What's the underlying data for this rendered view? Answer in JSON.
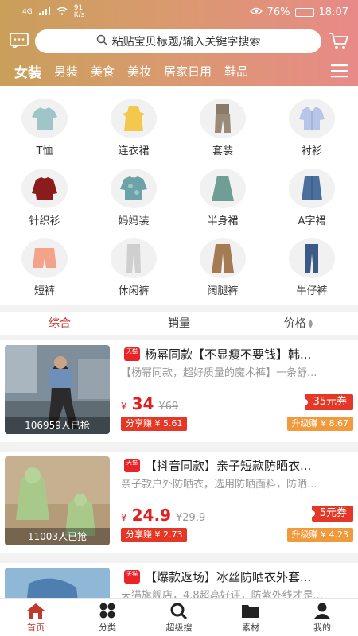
{
  "status": {
    "network": "4G",
    "speed": "91",
    "speed_unit": "K/s",
    "battery": "76%",
    "time": "18:07"
  },
  "search": {
    "placeholder": "粘贴宝贝标题/输入关键字搜索"
  },
  "categories": [
    "女装",
    "男装",
    "美食",
    "美妆",
    "居家日用",
    "鞋品"
  ],
  "subcategories": [
    "T恤",
    "连衣裙",
    "套装",
    "衬衫",
    "针织衫",
    "妈妈装",
    "半身裙",
    "A字裙",
    "短裤",
    "休闲裤",
    "阔腿裤",
    "牛仔裤"
  ],
  "sort": {
    "items": [
      "综合",
      "销量",
      "价格"
    ]
  },
  "products": [
    {
      "badge": "天猫",
      "title": "杨幂同款【不显瘦不要钱】韩...",
      "desc": "【杨幂同款，超好质量的魔术裤】一条舒...",
      "yen": "¥",
      "price": "34",
      "old_price": "¥69",
      "coupon": "35元券",
      "share": "分享赚 ¥ 5.61",
      "upgrade": "升级赚 ¥ 8.67",
      "sold": "106959人已抢"
    },
    {
      "badge": "天猫",
      "title": "【抖音同款】亲子短款防晒衣...",
      "desc": "亲子款户外防晒衣，选用防晒面料，防晒...",
      "yen": "¥",
      "price": "24.9",
      "old_price": "¥29.9",
      "coupon": "5元券",
      "share": "分享赚 ¥ 2.73",
      "upgrade": "升级赚 ¥ 4.23",
      "sold": "11003人已抢"
    },
    {
      "badge": "天猫",
      "title": "【爆款返场】冰丝防晒衣外套...",
      "desc": "天猫旗舰店，4.8超高好评，防紫外线才是...",
      "yen": "",
      "price": "",
      "old_price": "",
      "coupon": "",
      "share": "",
      "upgrade": "",
      "sold": ""
    }
  ],
  "tabbar": [
    "首页",
    "分类",
    "超级搜",
    "素材",
    "我的"
  ],
  "colors": {
    "accent": "#c0392b",
    "price": "#e02020",
    "coupon": "#e53725",
    "upgrade": "#f09a3c"
  }
}
